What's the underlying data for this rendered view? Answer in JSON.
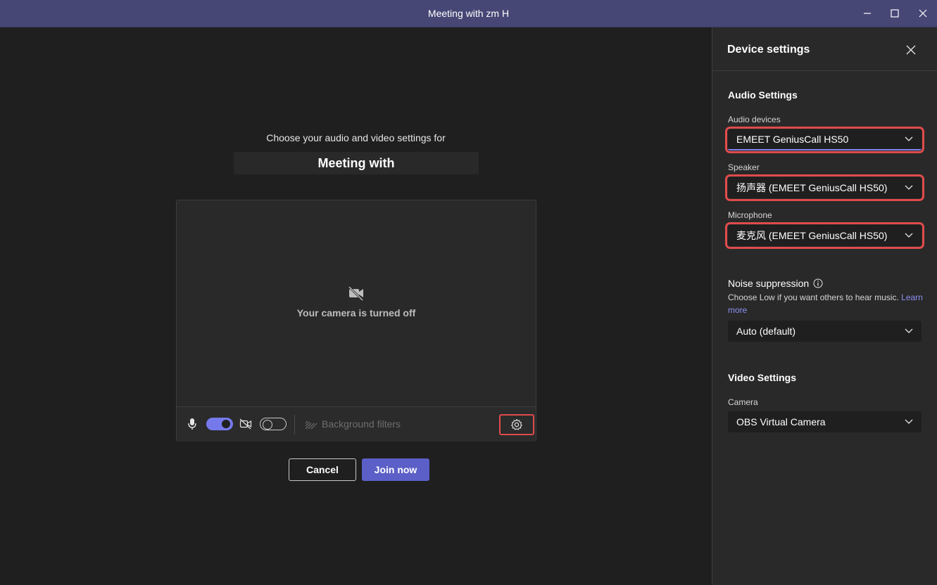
{
  "window": {
    "title": "Meeting with zm H",
    "controls": [
      "minimize-icon",
      "maximize-icon",
      "close-icon"
    ]
  },
  "prejoin": {
    "choose_text": "Choose your audio and video settings for",
    "meeting_title": "Meeting with",
    "camera_off_text": "Your camera is turned off",
    "mic_toggle_on": true,
    "camera_toggle_on": false,
    "background_filters_label": "Background filters",
    "cancel_label": "Cancel",
    "join_label": "Join now"
  },
  "device_settings": {
    "title": "Device settings",
    "audio_section_title": "Audio Settings",
    "audio_devices_label": "Audio devices",
    "audio_devices_value": "EMEET GeniusCall HS50",
    "speaker_label": "Speaker",
    "speaker_value": "扬声器 (EMEET GeniusCall HS50)",
    "microphone_label": "Microphone",
    "microphone_value": "麦克风 (EMEET GeniusCall HS50)",
    "noise_label": "Noise suppression",
    "noise_help": "Choose Low if you want others to hear music.",
    "noise_link": "Learn more",
    "noise_value": "Auto (default)",
    "video_section_title": "Video Settings",
    "camera_label": "Camera",
    "camera_value": "OBS Virtual Camera"
  },
  "colors": {
    "titlebar": "#464775",
    "accent": "#5b5fc7",
    "toggle_on": "#7579eb",
    "highlight": "#e04b4b",
    "background": "#1f1f1f",
    "panel": "#292929"
  }
}
